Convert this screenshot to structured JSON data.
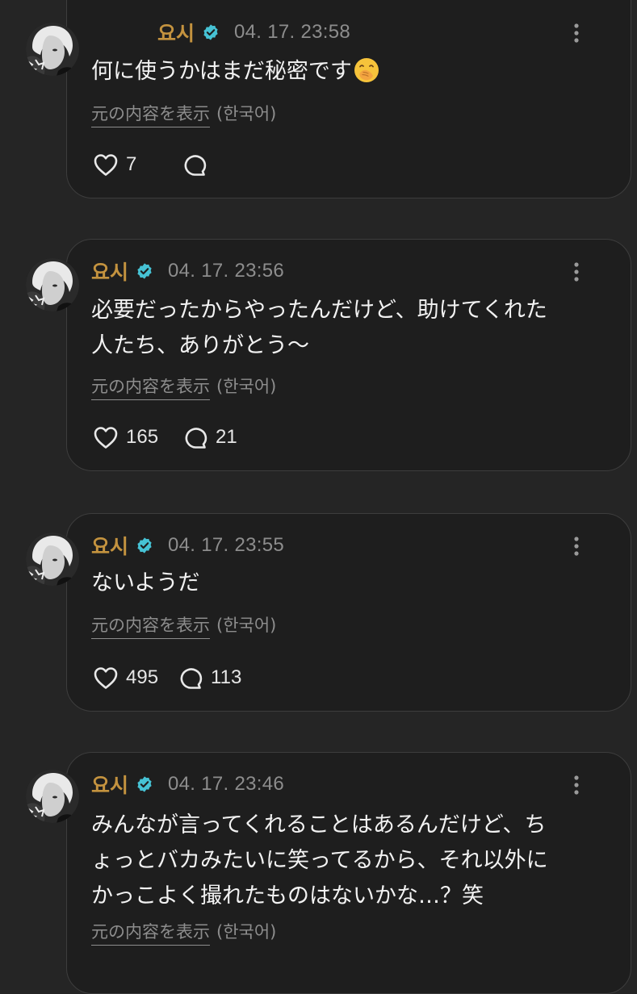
{
  "posts": [
    {
      "username": "요시",
      "verified": true,
      "timestamp": "04. 17. 23:58",
      "text_lines": [
        "何に使うかはまだ秘密です"
      ],
      "has_emoji": true,
      "emoji": "hand-over-mouth-face",
      "translate_label": "元の内容を表示",
      "translate_lang": "(한국어)",
      "likes": "7",
      "replies": ""
    },
    {
      "username": "요시",
      "verified": true,
      "timestamp": "04. 17. 23:56",
      "text_lines": [
        "必要だったからやったんだけど、助けてくれた",
        "人たち、ありがとう～"
      ],
      "has_emoji": false,
      "translate_label": "元の内容を表示",
      "translate_lang": "(한국어)",
      "likes": "165",
      "replies": "21"
    },
    {
      "username": "요시",
      "verified": true,
      "timestamp": "04. 17. 23:55",
      "text_lines": [
        "ないようだ"
      ],
      "has_emoji": false,
      "translate_label": "元の内容を表示",
      "translate_lang": "(한국어)",
      "likes": "495",
      "replies": "113"
    },
    {
      "username": "요시",
      "verified": true,
      "timestamp": "04. 17. 23:46",
      "text_lines": [
        "みんなが言ってくれることはあるんだけど、ち",
        "ょっとバカみたいに笑ってるから、それ以外に",
        "かっこよく撮れたものはないかな…？笑"
      ],
      "has_emoji": false,
      "translate_label": "元の内容を表示",
      "translate_lang": "(한국어)",
      "likes": "",
      "replies": ""
    }
  ],
  "icons": {
    "like": "heart-outline-icon",
    "reply": "speech-bubble-outline-icon",
    "more": "vertical-ellipsis-icon",
    "verified": "verified-badge-icon"
  },
  "colors": {
    "background": "#252525",
    "card": "#1e1e1e",
    "card_border": "#3d3d3d",
    "username": "#c4933f",
    "verified_badge": "#46c2d4",
    "muted_text": "#8d8d8d",
    "body_text": "#f2f2f2"
  }
}
